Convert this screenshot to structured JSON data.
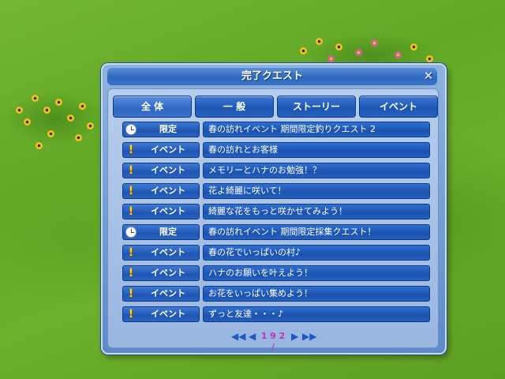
{
  "window": {
    "title": "完了クエスト",
    "close_icon": "close-icon"
  },
  "tabs": [
    {
      "label": "全 体"
    },
    {
      "label": "一 般"
    },
    {
      "label": "ストーリー"
    },
    {
      "label": "イベント"
    }
  ],
  "quests": [
    {
      "icon": "clock-icon",
      "type": "限定",
      "title": "春の訪れイベント 期間限定釣りクエスト 2"
    },
    {
      "icon": "exclamation-icon",
      "type": "イベント",
      "title": "春の訪れとお客様"
    },
    {
      "icon": "exclamation-icon",
      "type": "イベント",
      "title": "メモリーとハナのお勉強！？"
    },
    {
      "icon": "exclamation-icon",
      "type": "イベント",
      "title": "花よ綺麗に咲いて！"
    },
    {
      "icon": "exclamation-icon",
      "type": "イベント",
      "title": "綺麗な花をもっと咲かせてみよう！"
    },
    {
      "icon": "clock-icon",
      "type": "限定",
      "title": "春の訪れイベント 期間限定採集クエスト！"
    },
    {
      "icon": "exclamation-icon",
      "type": "イベント",
      "title": "春の花でいっぱいの村♪"
    },
    {
      "icon": "exclamation-icon",
      "type": "イベント",
      "title": "ハナのお願いを叶えよう！"
    },
    {
      "icon": "exclamation-icon",
      "type": "イベント",
      "title": "お花をいっぱい集めよう！"
    },
    {
      "icon": "exclamation-icon",
      "type": "イベント",
      "title": "ずっと友達・・・♪"
    }
  ],
  "pager": {
    "first_icon": "first-page-icon",
    "prev_icon": "prev-page-icon",
    "page_text": "1 9 2 /",
    "next_icon": "next-page-icon",
    "last_icon": "last-page-icon"
  },
  "colors": {
    "accent": "#1d55b2",
    "page_number": "#c032b8",
    "alert_icon": "#ffd21a"
  }
}
